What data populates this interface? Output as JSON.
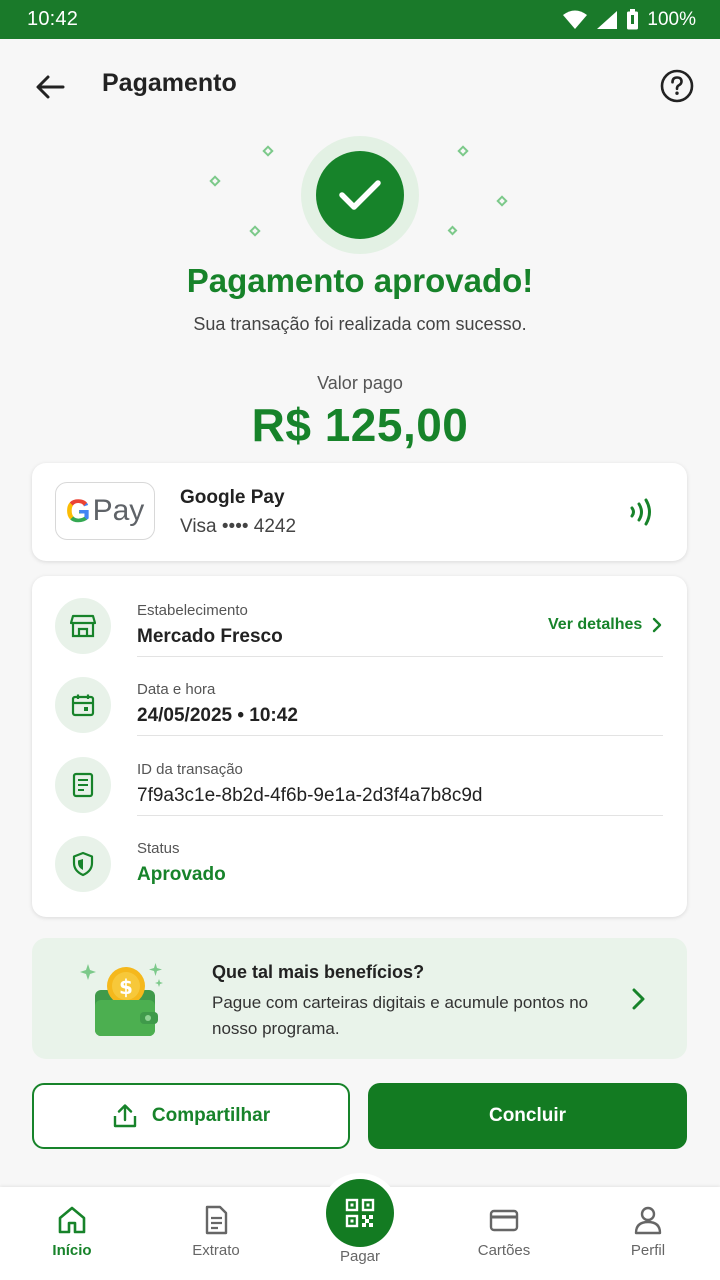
{
  "status_bar": {
    "time": "10:42",
    "battery": "100%"
  },
  "header": {
    "title": "Pagamento"
  },
  "result": {
    "headline": "Pagamento aprovado!",
    "subline": "Sua transação foi realizada com sucesso.",
    "amount_label": "Valor pago",
    "amount": "R$ 125,00"
  },
  "payment_method": {
    "logo_g": "G",
    "logo_pay": "Pay",
    "name": "Google Pay",
    "card": "Visa •••• 4242"
  },
  "details": {
    "merchant_label": "Estabelecimento",
    "merchant_value": "Mercado Fresco",
    "details_link": "Ver detalhes",
    "datetime_label": "Data e hora",
    "datetime_value": "24/05/2025 • 10:42",
    "txid_label": "ID da transação",
    "txid_value": "7f9a3c1e-8b2d-4f6b-9e1a-2d3f4a7b8c9d",
    "status_label": "Status",
    "status_value": "Aprovado"
  },
  "promo": {
    "title": "Que tal mais benefícios?",
    "text": "Pague com carteiras digitais e acumule pontos no nosso programa."
  },
  "actions": {
    "share": "Compartilhar",
    "done": "Concluir"
  },
  "nav": {
    "home": "Início",
    "statement": "Extrato",
    "pay": "Pagar",
    "cards": "Cartões",
    "profile": "Perfil"
  },
  "colors": {
    "brand": "#17832a",
    "status_bar": "#1a7a2a",
    "soft": "#e9f3ea"
  }
}
